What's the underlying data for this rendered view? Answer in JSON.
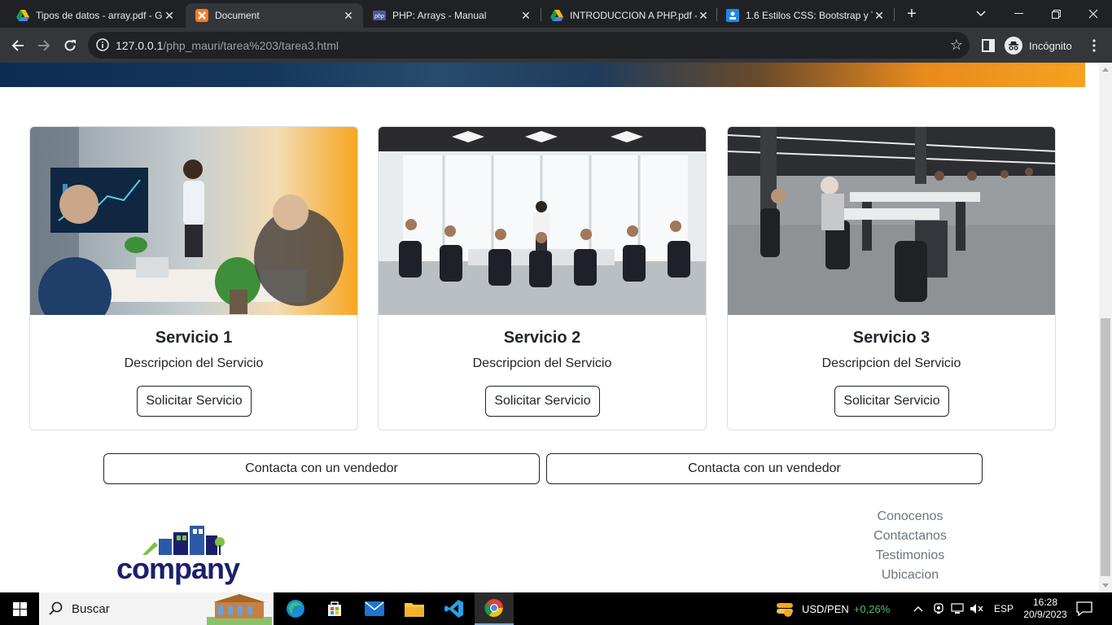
{
  "browser": {
    "tabs": [
      {
        "title": "Tipos de datos - array.pdf - G",
        "icon": "google-drive-icon",
        "active": false
      },
      {
        "title": "Document",
        "icon": "xampp-icon",
        "active": true
      },
      {
        "title": "PHP: Arrays - Manual",
        "icon": "php-icon",
        "active": false
      },
      {
        "title": "INTRODUCCION A PHP.pdf - ",
        "icon": "google-drive-icon",
        "active": false
      },
      {
        "title": "1.6 Estilos CSS: Bootstrap y T",
        "icon": "classroom-icon",
        "active": false
      }
    ],
    "url_host": "127.0.0.1",
    "url_path": "/php_mauri/tarea%203/tarea3.html",
    "profile_label": "Incógnito"
  },
  "cards": [
    {
      "title": "Servicio 1",
      "description": "Descripcion del Servicio",
      "button": "Solicitar Servicio"
    },
    {
      "title": "Servicio 2",
      "description": "Descripcion del Servicio",
      "button": "Solicitar Servicio"
    },
    {
      "title": "Servicio 3",
      "description": "Descripcion del Servicio",
      "button": "Solicitar Servicio"
    }
  ],
  "contact_buttons": [
    "Contacta con un vendedor",
    "Contacta con un vendedor"
  ],
  "logo_text": "company",
  "footer_links": [
    "Conocenos",
    "Contactanos",
    "Testimonios",
    "Ubicacion"
  ],
  "taskbar": {
    "search_label": "Buscar",
    "ticker_symbol": "USD/PEN",
    "ticker_change": "+0,26%",
    "language": "ESP",
    "time": "16:28",
    "date": "20/9/2023"
  },
  "colors": {
    "ticker_positive": "#4cc26a",
    "logo_navy": "#1b1f6b",
    "logo_blue": "#2d5aa8",
    "logo_green": "#7cc242"
  }
}
